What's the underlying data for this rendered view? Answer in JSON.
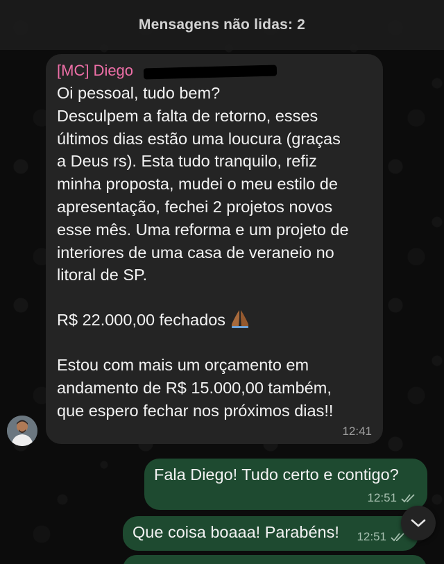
{
  "banner": {
    "text": "Mensagens não lidas: 2"
  },
  "incoming": {
    "sender": "[MC] Diego",
    "lines_p1": [
      "Oi pessoal, tudo bem?",
      "Desculpem a falta de retorno, esses",
      "últimos dias estão uma loucura (graças",
      "a Deus rs). Esta tudo tranquilo, refiz",
      "minha proposta, mudei o meu estilo de",
      "apresentação, fechei 2 projetos novos",
      "esse mês. Uma reforma e um projeto de",
      "interiores de uma casa de veraneio no",
      "litoral de SP."
    ],
    "amount_line": "R$ 22.000,00 fechados",
    "emoji_icon": "folded-hands-emoji",
    "lines_p3": [
      "Estou com mais um orçamento em",
      "andamento de R$ 15.000,00 também,",
      "que espero fechar nos próximos dias!!"
    ],
    "time": "12:41"
  },
  "outgoing": [
    {
      "text": "Fala Diego! Tudo certo e contigo?",
      "time": "12:51",
      "status_icon": "double-check-icon"
    },
    {
      "text": "Que coisa boaaa! Parabéns!",
      "time": "12:51",
      "status_icon": "double-check-icon"
    }
  ],
  "colors": {
    "sender_name": "#ee6fa7",
    "incoming_bubble": "#242424",
    "outgoing_bubble": "#1e4a30",
    "background": "#0c0c0c"
  },
  "icons": {
    "scroll_down": "chevron-down-icon",
    "avatar": "contact-avatar"
  }
}
